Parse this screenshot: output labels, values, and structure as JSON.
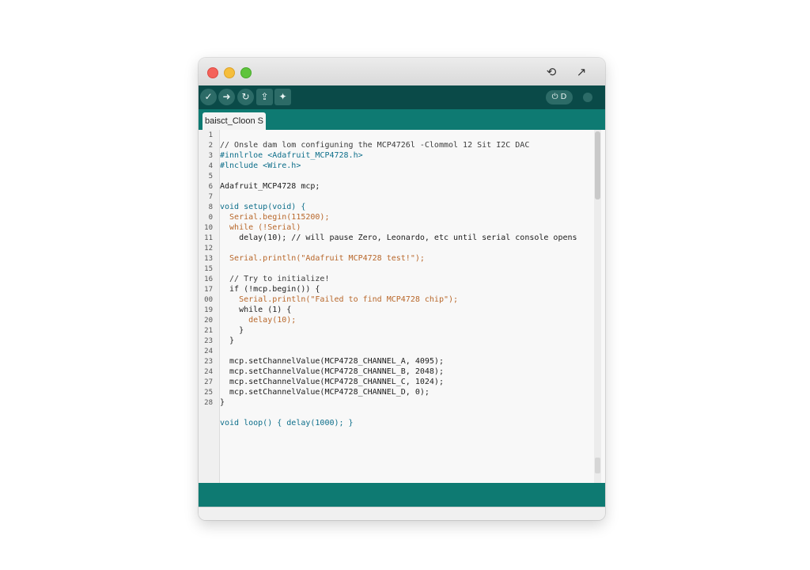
{
  "window": {
    "title_icons": [
      "reset-icon",
      "arrow-up-right-icon"
    ]
  },
  "toolbar": {
    "verify_glyph": "✓",
    "upload_glyph": "➜",
    "debug_glyph": "↻",
    "export_glyph": "⇪",
    "plotter_glyph": "✦",
    "serial_monitor_label": "⏻ D"
  },
  "tab": {
    "label": "baisct_Cloon S"
  },
  "line_numbers": [
    "1",
    "2",
    "3",
    "4",
    "5",
    "6",
    "7",
    "8",
    "0",
    "10",
    "11",
    "12",
    "13",
    "15",
    "16",
    "17",
    "00",
    "19",
    "20",
    "21",
    "23",
    "24",
    "23",
    "24",
    "27",
    "25",
    "28"
  ],
  "code": {
    "l1": "// Onsle dam lom configuning the MCP4726l -Clommol 12 Sit I2C DAC",
    "l2": "#innlrloe <Adafruit_MCP4728.h>",
    "l3": "#lnclude <Wire.h>",
    "l4": "Adafruit_MCP4728 mcp;",
    "l5": "void setup(void) {",
    "l6": "  Serial.begin(115200);",
    "l7": "  while (!Serial)",
    "l8": "    delay(10); // will pause Zero, Leonardo, etc until serial console opens",
    "l9": "  Serial.println(\"Adafruit MCP4728 test!\");",
    "l10": "  // Try to initialize!",
    "l11": "  if (!mcp.begin()) {",
    "l12": "    Serial.println(\"Failed to find MCP4728 chip\");",
    "l13": "    while (1) {",
    "l14": "      delay(10);",
    "l15": "    }",
    "l16": "  }",
    "l17": "  mcp.setChannelValue(MCP4728_CHANNEL_A, 4095);",
    "l18": "  mcp.setChannelValue(MCP4728_CHANNEL_B, 2048);",
    "l19": "  mcp.setChannelValue(MCP4728_CHANNEL_C, 1024);",
    "l20": "  mcp.setChannelValue(MCP4728_CHANNEL_D, 0);",
    "l21": "}",
    "l22": "void loop() { delay(1000); }"
  }
}
